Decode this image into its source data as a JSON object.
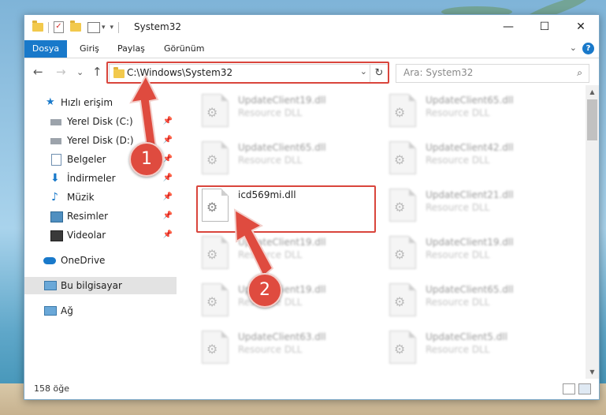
{
  "window": {
    "title": "System32"
  },
  "controls": {
    "minimize": "—",
    "maximize": "☐",
    "close": "✕"
  },
  "ribbon": {
    "tabs": [
      "Dosya",
      "Giriş",
      "Paylaş",
      "Görünüm"
    ],
    "expand": "⌄",
    "help": "?"
  },
  "nav": {
    "back": "←",
    "forward": "→",
    "recent": "⌄",
    "up": "↑"
  },
  "address": {
    "path": "C:\\Windows\\System32",
    "dropdown": "⌄",
    "refresh": "↻"
  },
  "search": {
    "placeholder": "Ara: System32",
    "icon": "⌕"
  },
  "navpane": {
    "items": [
      {
        "label": "Hızlı erişim",
        "icon": "star-icon",
        "pin": ""
      },
      {
        "label": "Yerel Disk (C:)",
        "icon": "drive-icon",
        "pin": "📌"
      },
      {
        "label": "Yerel Disk (D:)",
        "icon": "drive-icon",
        "pin": "📌"
      },
      {
        "label": "Belgeler",
        "icon": "documents-icon",
        "pin": "📌"
      },
      {
        "label": "İndirmeler",
        "icon": "download-icon",
        "pin": "📌"
      },
      {
        "label": "Müzik",
        "icon": "music-icon",
        "pin": "📌"
      },
      {
        "label": "Resimler",
        "icon": "pictures-icon",
        "pin": "📌"
      },
      {
        "label": "Videolar",
        "icon": "video-icon",
        "pin": "📌"
      },
      {
        "label": "OneDrive",
        "icon": "cloud-icon",
        "pin": ""
      },
      {
        "label": "Bu bilgisayar",
        "icon": "computer-icon",
        "pin": ""
      },
      {
        "label": "Ağ",
        "icon": "network-icon",
        "pin": ""
      }
    ]
  },
  "files": {
    "left": [
      {
        "name": "UpdateClient19.dll",
        "desc": "Resource DLL"
      },
      {
        "name": "UpdateClient65.dll",
        "desc": "Resource DLL"
      },
      {
        "name": "icd569mi.dll",
        "desc": ""
      },
      {
        "name": "UpdateClient19.dll",
        "desc": "Resource DLL"
      },
      {
        "name": "UpdateClient19.dll",
        "desc": "Resource DLL"
      },
      {
        "name": "UpdateClient63.dll",
        "desc": "Resource DLL"
      }
    ],
    "right": [
      {
        "name": "UpdateClient65.dll",
        "desc": "Resource DLL"
      },
      {
        "name": "UpdateClient42.dll",
        "desc": "Resource DLL"
      },
      {
        "name": "UpdateClient21.dll",
        "desc": "Resource DLL"
      },
      {
        "name": "UpdateClient19.dll",
        "desc": "Resource DLL"
      },
      {
        "name": "UpdateClient65.dll",
        "desc": "Resource DLL"
      },
      {
        "name": "UpdateClient5.dll",
        "desc": "Resource DLL"
      }
    ]
  },
  "status": {
    "count": "158 öğe"
  },
  "callouts": [
    "1",
    "2"
  ],
  "colors": {
    "accent": "#1979ca",
    "annotation": "#d9453c"
  }
}
